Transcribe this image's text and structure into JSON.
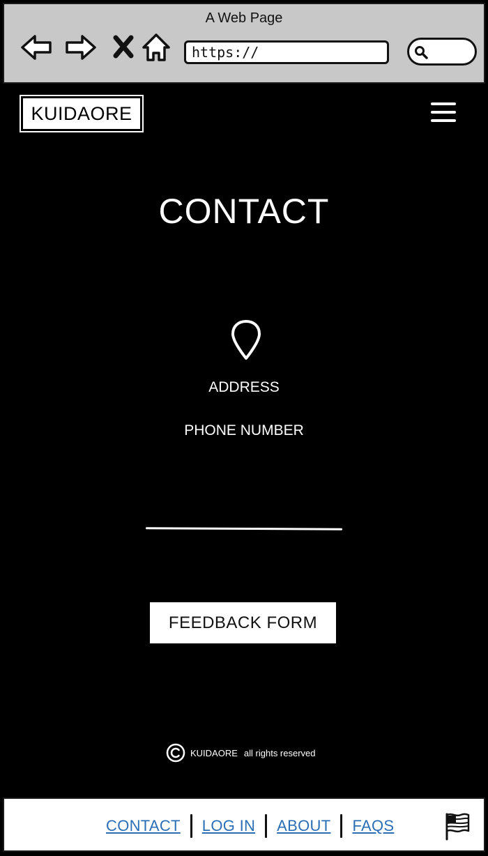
{
  "browser": {
    "title": "A Web Page",
    "url": "https://"
  },
  "header": {
    "logo": "KUIDAORE"
  },
  "main": {
    "title": "CONTACT",
    "address_label": "ADDRESS",
    "phone_label": "PHONE NUMBER",
    "feedback_button": "FEEDBACK FORM"
  },
  "copyright": {
    "brand": "KUIDAORE",
    "text": "all rights reserved"
  },
  "footer": {
    "links": [
      "CONTACT",
      "LOG IN",
      "ABOUT",
      "FAQS"
    ]
  },
  "colors": {
    "background": "#000000",
    "chrome": "#c8c8c8",
    "link": "#2a6fb5"
  }
}
